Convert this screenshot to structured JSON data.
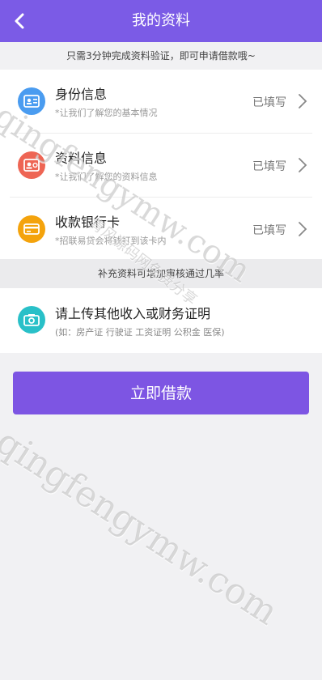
{
  "header": {
    "title": "我的资料"
  },
  "notice": "只需3分钟完成资料验证，即可申请借款哦~",
  "items": [
    {
      "title": "身份信息",
      "desc": "*让我们了解您的基本情况",
      "status": "已填写",
      "icon": "id-card-icon",
      "color": "#4a9cf0"
    },
    {
      "title": "资料信息",
      "desc": "*让我们了解您的资料信息",
      "status": "已填写",
      "icon": "profile-card-icon",
      "color": "#ee6554"
    },
    {
      "title": "收款银行卡",
      "desc": "*招联易贷会将钱打到该卡内",
      "status": "已填写",
      "icon": "bank-card-icon",
      "color": "#f4a30c"
    }
  ],
  "info_bar": "补充资料可增加审核通过几率",
  "upload": {
    "title": "请上传其他收入或财务证明",
    "desc": "(如：房产证 行驶证 工资证明 公积金 医保)",
    "icon": "camera-icon",
    "color": "#29c0c8"
  },
  "cta_label": "立即借款",
  "watermark": {
    "text": "qingfengymw.com",
    "sub": "青风源码网免费分享"
  }
}
